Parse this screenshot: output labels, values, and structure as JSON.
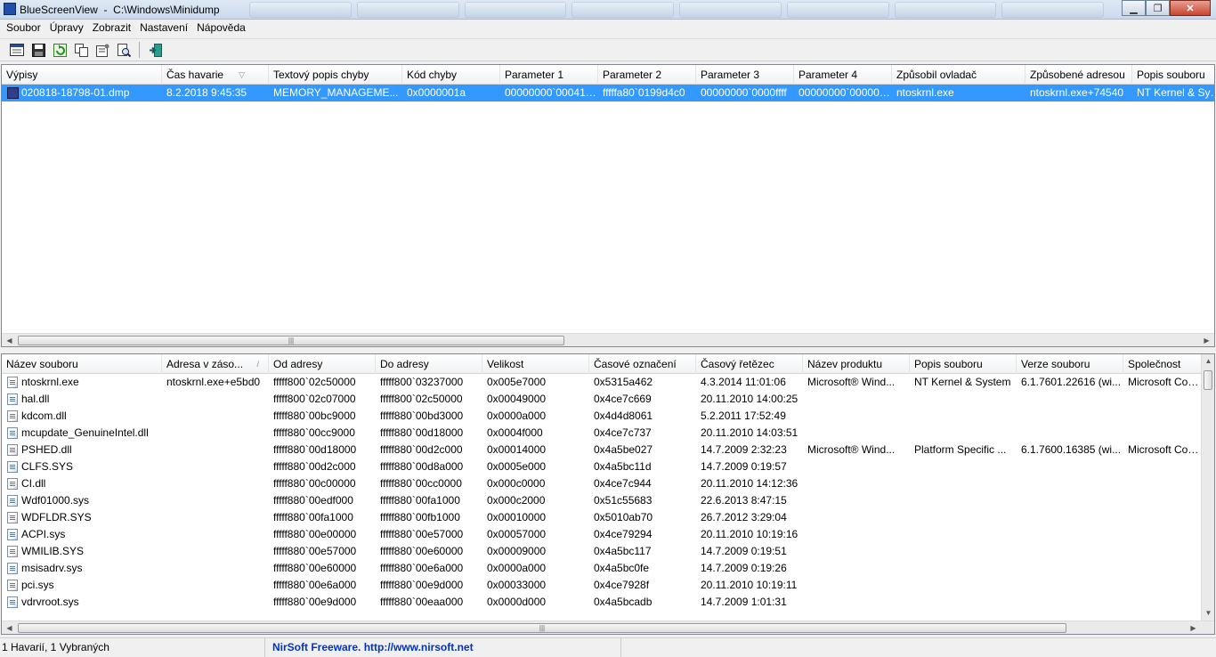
{
  "window": {
    "title": "BlueScreenView  -  C:\\Windows\\Minidump",
    "minimize_label": "▁",
    "maximize_label": "❐",
    "close_label": "✕"
  },
  "menu": [
    "Soubor",
    "Úpravy",
    "Zobrazit",
    "Nastavení",
    "Nápověda"
  ],
  "toolbar": {
    "buttons": [
      "html-report-icon",
      "save-icon",
      "refresh-icon",
      "copy-icon",
      "properties-icon",
      "find-icon",
      "exit-icon"
    ]
  },
  "crash_list": {
    "columns": [
      "Výpisy",
      "Čas havarie",
      "Textový popis chyby",
      "Kód chyby",
      "Parameter 1",
      "Parameter 2",
      "Parameter 3",
      "Parameter 4",
      "Způsobil ovladač",
      "Způsobené adresou",
      "Popis souboru"
    ],
    "sort_indicator": "▽",
    "rows": [
      [
        "020818-18798-01.dmp",
        "8.2.2018 9:45:35",
        "MEMORY_MANAGEME...",
        "0x0000001a",
        "00000000`000417...",
        "fffffa80`0199d4c0",
        "00000000`0000ffff",
        "00000000`000000...",
        "ntoskrnl.exe",
        "ntoskrnl.exe+74540",
        "NT Kernel & System"
      ]
    ]
  },
  "driver_list": {
    "columns": [
      "Název souboru",
      "Adresa v záso...",
      "Od adresy",
      "Do adresy",
      "Velikost",
      "Časové označení",
      "Časový řetězec",
      "Název produktu",
      "Popis souboru",
      "Verze souboru",
      "Společnost"
    ],
    "sort_indicator": "/",
    "rows": [
      [
        "ntoskrnl.exe",
        "ntoskrnl.exe+e5bd0",
        "fffff800`02c50000",
        "fffff800`03237000",
        "0x005e7000",
        "0x5315a462",
        "4.3.2014 11:01:06",
        "Microsoft® Wind...",
        "NT Kernel & System",
        "6.1.7601.22616 (wi...",
        "Microsoft Corporation"
      ],
      [
        "hal.dll",
        "",
        "fffff800`02c07000",
        "fffff800`02c50000",
        "0x00049000",
        "0x4ce7c669",
        "20.11.2010 14:00:25",
        "",
        "",
        "",
        ""
      ],
      [
        "kdcom.dll",
        "",
        "fffff880`00bc9000",
        "fffff880`00bd3000",
        "0x0000a000",
        "0x4d4d8061",
        "5.2.2011 17:52:49",
        "",
        "",
        "",
        ""
      ],
      [
        "mcupdate_GenuineIntel.dll",
        "",
        "fffff880`00cc9000",
        "fffff880`00d18000",
        "0x0004f000",
        "0x4ce7c737",
        "20.11.2010 14:03:51",
        "",
        "",
        "",
        ""
      ],
      [
        "PSHED.dll",
        "",
        "fffff880`00d18000",
        "fffff880`00d2c000",
        "0x00014000",
        "0x4a5be027",
        "14.7.2009 2:32:23",
        "Microsoft® Wind...",
        "Platform Specific ...",
        "6.1.7600.16385 (wi...",
        "Microsoft Corporation"
      ],
      [
        "CLFS.SYS",
        "",
        "fffff880`00d2c000",
        "fffff880`00d8a000",
        "0x0005e000",
        "0x4a5bc11d",
        "14.7.2009 0:19:57",
        "",
        "",
        "",
        ""
      ],
      [
        "CI.dll",
        "",
        "fffff880`00c00000",
        "fffff880`00cc0000",
        "0x000c0000",
        "0x4ce7c944",
        "20.11.2010 14:12:36",
        "",
        "",
        "",
        ""
      ],
      [
        "Wdf01000.sys",
        "",
        "fffff880`00edf000",
        "fffff880`00fa1000",
        "0x000c2000",
        "0x51c55683",
        "22.6.2013 8:47:15",
        "",
        "",
        "",
        ""
      ],
      [
        "WDFLDR.SYS",
        "",
        "fffff880`00fa1000",
        "fffff880`00fb1000",
        "0x00010000",
        "0x5010ab70",
        "26.7.2012 3:29:04",
        "",
        "",
        "",
        ""
      ],
      [
        "ACPI.sys",
        "",
        "fffff880`00e00000",
        "fffff880`00e57000",
        "0x00057000",
        "0x4ce79294",
        "20.11.2010 10:19:16",
        "",
        "",
        "",
        ""
      ],
      [
        "WMILIB.SYS",
        "",
        "fffff880`00e57000",
        "fffff880`00e60000",
        "0x00009000",
        "0x4a5bc117",
        "14.7.2009 0:19:51",
        "",
        "",
        "",
        ""
      ],
      [
        "msisadrv.sys",
        "",
        "fffff880`00e60000",
        "fffff880`00e6a000",
        "0x0000a000",
        "0x4a5bc0fe",
        "14.7.2009 0:19:26",
        "",
        "",
        "",
        ""
      ],
      [
        "pci.sys",
        "",
        "fffff880`00e6a000",
        "fffff880`00e9d000",
        "0x00033000",
        "0x4ce7928f",
        "20.11.2010 10:19:11",
        "",
        "",
        "",
        ""
      ],
      [
        "vdrvroot.sys",
        "",
        "fffff880`00e9d000",
        "fffff880`00eaa000",
        "0x0000d000",
        "0x4a5bcadb",
        "14.7.2009 1:01:31",
        "",
        "",
        "",
        ""
      ]
    ]
  },
  "status": {
    "count": "1 Havarií, 1 Vybraných",
    "link": "NirSoft Freeware.  http://www.nirsoft.net"
  }
}
